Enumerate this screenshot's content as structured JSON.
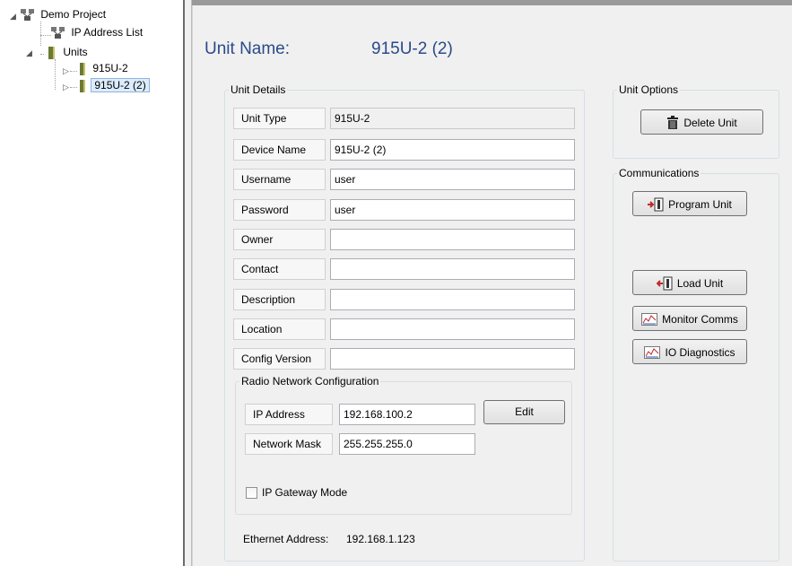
{
  "tree": {
    "root": "Demo Project",
    "ip_address_list": "IP Address List",
    "units": "Units",
    "unit1": "915U-2",
    "unit2": "915U-2 (2)"
  },
  "header": {
    "caption": "Unit Name:",
    "value": "915U-2 (2)"
  },
  "unit_details": {
    "legend": "Unit Details",
    "fields": [
      {
        "label": "Unit Type",
        "value": "915U-2"
      },
      {
        "label": "Device Name",
        "value": "915U-2 (2)"
      },
      {
        "label": "Username",
        "value": "user"
      },
      {
        "label": "Password",
        "value": "user"
      },
      {
        "label": "Owner",
        "value": ""
      },
      {
        "label": "Contact",
        "value": ""
      },
      {
        "label": "Description",
        "value": ""
      },
      {
        "label": "Location",
        "value": ""
      },
      {
        "label": "Config Version",
        "value": ""
      }
    ]
  },
  "radio": {
    "legend": "Radio Network Configuration",
    "ip_label": "IP Address",
    "ip_value": "192.168.100.2",
    "mask_label": "Network Mask",
    "mask_value": "255.255.255.0",
    "edit": "Edit",
    "gateway": "IP Gateway Mode"
  },
  "ethernet": {
    "label": "Ethernet Address:",
    "value": "192.168.1.123"
  },
  "unit_options": {
    "legend": "Unit Options",
    "delete": "Delete Unit"
  },
  "communications": {
    "legend": "Communications",
    "program": "Program Unit",
    "load": "Load Unit",
    "monitor": "Monitor Comms",
    "io": "IO Diagnostics"
  },
  "colors": {
    "title": "#2a4a8a",
    "selection": "#dcecfc"
  }
}
